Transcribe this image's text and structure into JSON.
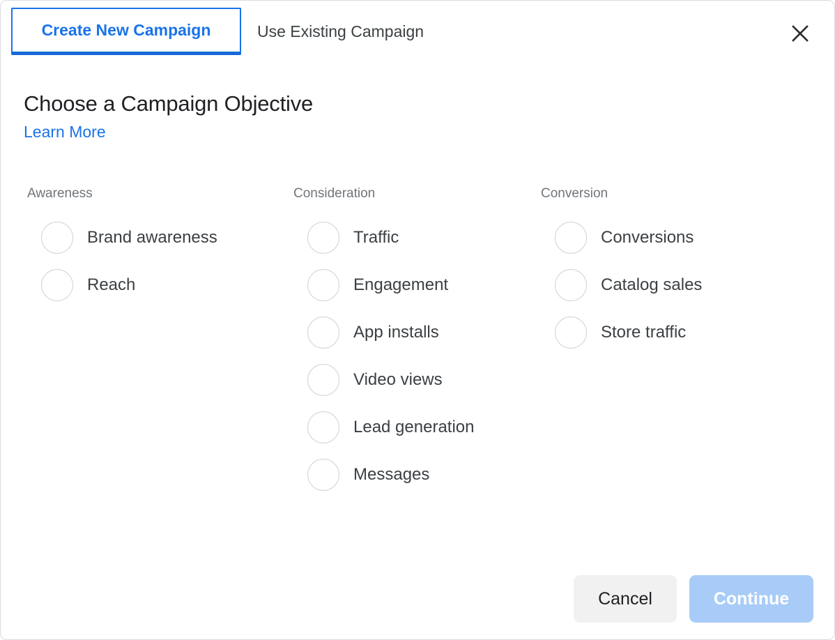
{
  "dialog": {
    "tabs": [
      {
        "label": "Create New Campaign",
        "active": true
      },
      {
        "label": "Use Existing Campaign",
        "active": false
      }
    ],
    "close_icon": "close-icon",
    "title": "Choose a Campaign Objective",
    "learn_more_label": "Learn More",
    "columns": [
      {
        "title": "Awareness",
        "options": [
          {
            "label": "Brand awareness",
            "selected": false
          },
          {
            "label": "Reach",
            "selected": false
          }
        ]
      },
      {
        "title": "Consideration",
        "options": [
          {
            "label": "Traffic",
            "selected": false
          },
          {
            "label": "Engagement",
            "selected": false
          },
          {
            "label": "App installs",
            "selected": false
          },
          {
            "label": "Video views",
            "selected": false
          },
          {
            "label": "Lead generation",
            "selected": false
          },
          {
            "label": "Messages",
            "selected": false
          }
        ]
      },
      {
        "title": "Conversion",
        "options": [
          {
            "label": "Conversions",
            "selected": false
          },
          {
            "label": "Catalog sales",
            "selected": false
          },
          {
            "label": "Store traffic",
            "selected": false
          }
        ]
      }
    ],
    "footer": {
      "cancel_label": "Cancel",
      "continue_label": "Continue",
      "continue_disabled": true
    },
    "colors": {
      "accent_blue": "#1a73e8",
      "tab_underline": "#1569d6",
      "text_primary": "#202124",
      "text_secondary": "#3c4043",
      "text_muted": "#70757a",
      "radio_border": "#d3d3d3",
      "cancel_bg": "#f1f1f1",
      "continue_bg": "#a8ccf7"
    }
  }
}
